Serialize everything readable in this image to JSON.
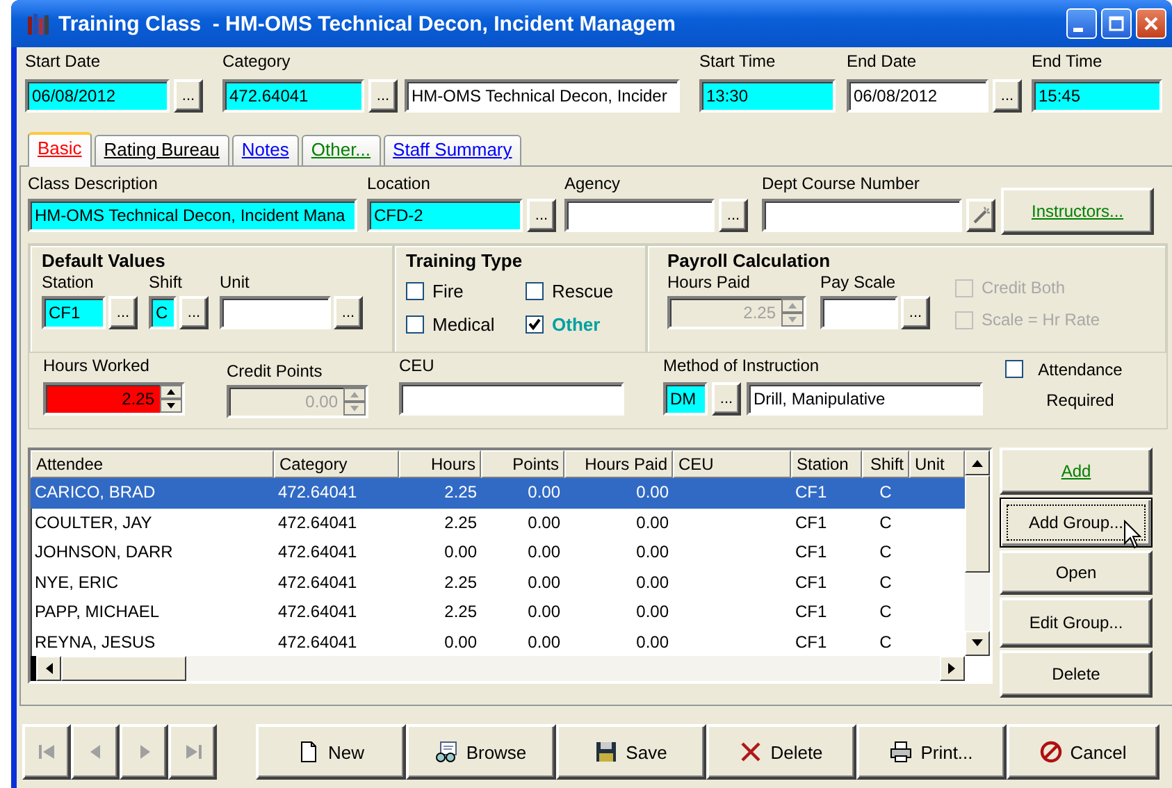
{
  "window": {
    "title": "Training Class  - HM-OMS Technical Decon, Incident Managem"
  },
  "header_fields": [
    {
      "label": "Start Date",
      "value": "06/08/2012",
      "required": true,
      "button": "..."
    },
    {
      "label": "Category",
      "value": "472.64041",
      "required": true,
      "button": "...",
      "description": "HM-OMS Technical Decon, Incider"
    },
    {
      "label": "Start Time",
      "value": "13:30",
      "required": true
    },
    {
      "label": "End Date",
      "value": "06/08/2012",
      "required": false,
      "button": "..."
    },
    {
      "label": "End Time",
      "value": "15:45",
      "required": true
    }
  ],
  "tabs": [
    {
      "label": "Basic",
      "selected": true,
      "color": "#ff0000"
    },
    {
      "label": "Rating Bureau",
      "selected": false,
      "color": "#000000"
    },
    {
      "label": "Notes",
      "selected": false,
      "color": "#0000ff"
    },
    {
      "label": "Other...",
      "selected": false,
      "color": "#008000"
    },
    {
      "label": "Staff Summary",
      "selected": false,
      "color": "#0000ff"
    }
  ],
  "class_fields": [
    {
      "label": "Class Description",
      "value": "HM-OMS Technical Decon, Incident Mana",
      "required": true
    },
    {
      "label": "Location",
      "value": "CFD-2",
      "required": true,
      "button": "..."
    },
    {
      "label": "Agency",
      "required": false,
      "button": "..."
    },
    {
      "label": "Dept Course Number",
      "required": false,
      "kind": "wand"
    }
  ],
  "instructors_button": "Instructors...",
  "default_values": {
    "title": "Default Values",
    "fields": [
      {
        "label": "Station",
        "value": "CF1",
        "required": true,
        "button": "..."
      },
      {
        "label": "Shift",
        "value": "C",
        "required": true,
        "button": "..."
      },
      {
        "label": "Unit",
        "required": false,
        "button": "..."
      }
    ]
  },
  "training_type": {
    "title": "Training Type",
    "options": [
      {
        "label": "Fire",
        "checked": false
      },
      {
        "label": "Rescue",
        "checked": false
      },
      {
        "label": "Medical",
        "checked": false
      },
      {
        "label": "Other",
        "checked": true
      }
    ]
  },
  "payroll": {
    "title": "Payroll Calculation",
    "hours_paid": {
      "label": "Hours Paid",
      "value": "2.25",
      "disabled": true
    },
    "pay_scale": {
      "label": "Pay Scale",
      "button": "..."
    },
    "options": [
      {
        "label": "Credit Both",
        "checked": false,
        "disabled": true
      },
      {
        "label": "Scale = Hr Rate",
        "checked": false,
        "disabled": true
      }
    ]
  },
  "hours_worked": {
    "label": "Hours Worked",
    "value": "2.25",
    "invalid": true
  },
  "credit_points": {
    "label": "Credit Points",
    "value": "0.00",
    "disabled": true
  },
  "ceu": {
    "label": "CEU"
  },
  "method": {
    "label": "Method of Instruction",
    "code": "DM",
    "required": true,
    "button": "...",
    "description": "Drill, Manipulative"
  },
  "attendance_required": {
    "label": "Attendance Required",
    "checked": false
  },
  "attendees": {
    "columns": [
      "Attendee",
      "Category",
      "Hours",
      "Points",
      "Hours Paid",
      "CEU",
      "Station",
      "Shift",
      "Unit"
    ],
    "rows": [
      {
        "cells": [
          "CARICO, BRAD",
          "472.64041",
          "2.25",
          "0.00",
          "0.00",
          "",
          "CF1",
          "C",
          ""
        ],
        "selected": true
      },
      {
        "cells": [
          "COULTER, JAY",
          "472.64041",
          "2.25",
          "0.00",
          "0.00",
          "",
          "CF1",
          "C",
          ""
        ],
        "selected": false
      },
      {
        "cells": [
          "JOHNSON, DARR",
          "472.64041",
          "0.00",
          "0.00",
          "0.00",
          "",
          "CF1",
          "C",
          ""
        ],
        "selected": false
      },
      {
        "cells": [
          "NYE, ERIC",
          "472.64041",
          "2.25",
          "0.00",
          "0.00",
          "",
          "CF1",
          "C",
          ""
        ],
        "selected": false
      },
      {
        "cells": [
          "PAPP, MICHAEL",
          "472.64041",
          "2.25",
          "0.00",
          "0.00",
          "",
          "CF1",
          "C",
          ""
        ],
        "selected": false
      },
      {
        "cells": [
          "REYNA, JESUS",
          "472.64041",
          "0.00",
          "0.00",
          "0.00",
          "",
          "CF1",
          "C",
          ""
        ],
        "selected": false
      }
    ]
  },
  "side_buttons": [
    {
      "label": "Add",
      "focused": false,
      "color": "#008000"
    },
    {
      "label": "Add Group...",
      "focused": true,
      "color": "#000000"
    },
    {
      "label": "Open",
      "focused": false,
      "color": "#000000"
    },
    {
      "label": "Edit Group...",
      "focused": false,
      "color": "#000000"
    },
    {
      "label": "Delete",
      "focused": false,
      "color": "#000000"
    }
  ],
  "nav_buttons": [
    {
      "kind": "first",
      "disabled": true
    },
    {
      "kind": "previous",
      "disabled": true
    },
    {
      "kind": "next",
      "disabled": true
    },
    {
      "kind": "last",
      "disabled": true
    }
  ],
  "actions": [
    {
      "kind": "new",
      "label": "New"
    },
    {
      "kind": "browse",
      "label": "Browse"
    },
    {
      "kind": "save",
      "label": "Save"
    },
    {
      "kind": "delete",
      "label": "Delete"
    },
    {
      "kind": "print",
      "label": "Print..."
    },
    {
      "kind": "cancel",
      "label": "Cancel"
    }
  ]
}
